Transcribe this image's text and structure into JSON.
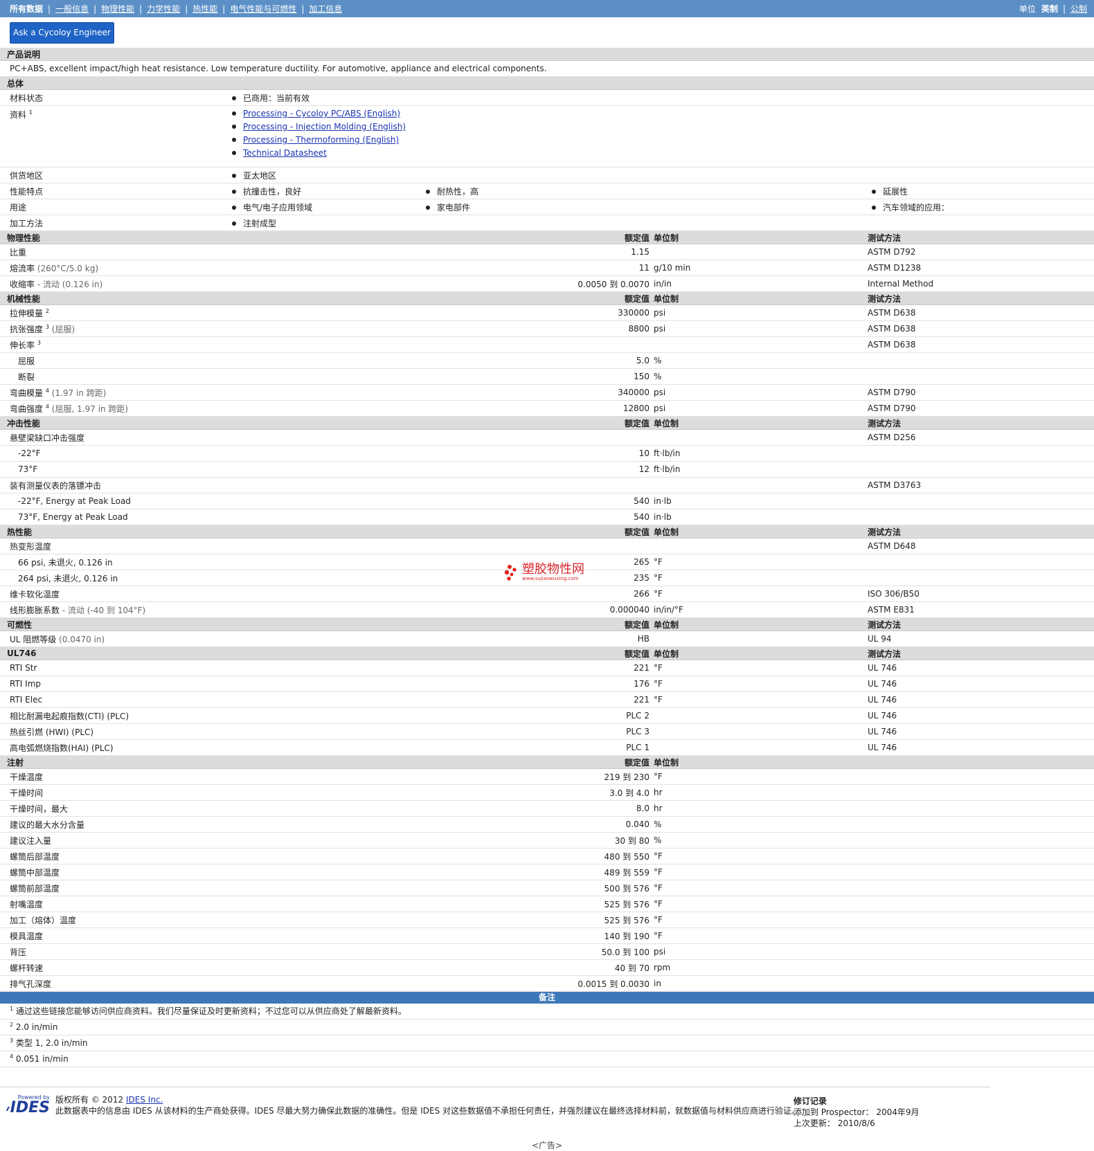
{
  "nav": {
    "items": [
      "所有数据",
      "一般信息",
      "物理性能",
      "力学性能",
      "热性能",
      "电气性能与可燃性",
      "加工信息"
    ],
    "units_label": "单位",
    "unit_english": "英制",
    "unit_metric": "公制"
  },
  "ask_button": "Ask a Cycoloy Engineer",
  "product": {
    "header": "产品说明",
    "desc": "PC+ABS, excellent impact/high heat resistance. Low temperature ductility. For automotive, appliance and electrical components."
  },
  "general": {
    "header": "总体",
    "status_label": "材料状态",
    "status_value": "已商用：当前有效",
    "docs_label": "资料",
    "docs_sup": "1",
    "docs": [
      "Processing - Cycoloy PC/ABS (English)",
      "Processing - Injection Molding (English)",
      "Processing - Thermoforming (English)",
      "Technical Datasheet"
    ],
    "region_label": "供货地区",
    "region_value": "亚太地区",
    "features_label": "性能特点",
    "features": [
      "抗撞击性，良好",
      "耐热性，高",
      "延展性"
    ],
    "uses_label": "用途",
    "uses": [
      "电气/电子应用领域",
      "家电部件",
      "汽车领域的应用："
    ],
    "process_label": "加工方法",
    "process_value": "注射成型"
  },
  "col": {
    "nominal": "额定值",
    "unit": "单位制",
    "method": "测试方法"
  },
  "physical": {
    "header": "物理性能",
    "rows": [
      {
        "label": "比重",
        "cond": "",
        "val": "1.15",
        "unit": "",
        "method": "ASTM D792"
      },
      {
        "label": "熔流率",
        "cond": "(260°C/5.0 kg)",
        "val": "11",
        "unit": "g/10 min",
        "method": "ASTM D1238"
      },
      {
        "label": "收缩率",
        "cond": "- 流动 (0.126 in)",
        "val": "0.0050 到 0.0070",
        "unit": "in/in",
        "method": "Internal Method"
      }
    ]
  },
  "mechanical": {
    "header": "机械性能",
    "rows": [
      {
        "label": "拉伸模量",
        "sup": "2",
        "cond": "",
        "val": "330000",
        "unit": "psi",
        "method": "ASTM D638"
      },
      {
        "label": "抗张强度",
        "sup": "3",
        "cond": "(屈服)",
        "val": "8800",
        "unit": "psi",
        "method": "ASTM D638"
      },
      {
        "label": "伸长率",
        "sup": "3",
        "cond": "",
        "val": "",
        "unit": "",
        "method": "ASTM D638"
      },
      {
        "label": "屈服",
        "sub": true,
        "val": "5.0",
        "unit": "%",
        "method": ""
      },
      {
        "label": "断裂",
        "sub": true,
        "val": "150",
        "unit": "%",
        "method": ""
      },
      {
        "label": "弯曲模量",
        "sup": "4",
        "cond": "(1.97 in 跨距)",
        "val": "340000",
        "unit": "psi",
        "method": "ASTM D790"
      },
      {
        "label": "弯曲强度",
        "sup": "4",
        "cond": "(屈服, 1.97 in 跨距)",
        "val": "12800",
        "unit": "psi",
        "method": "ASTM D790"
      }
    ]
  },
  "impact": {
    "header": "冲击性能",
    "rows": [
      {
        "label": "悬壁梁缺口冲击强度",
        "val": "",
        "unit": "",
        "method": "ASTM D256"
      },
      {
        "label": "-22°F",
        "sub": true,
        "val": "10",
        "unit": "ft·lb/in",
        "method": ""
      },
      {
        "label": "73°F",
        "sub": true,
        "val": "12",
        "unit": "ft·lb/in",
        "method": ""
      },
      {
        "label": "装有测量仪表的落镖冲击",
        "val": "",
        "unit": "",
        "method": "ASTM D3763"
      },
      {
        "label": "-22°F, Energy at Peak Load",
        "sub": true,
        "val": "540",
        "unit": "in·lb",
        "method": ""
      },
      {
        "label": "73°F, Energy at Peak Load",
        "sub": true,
        "val": "540",
        "unit": "in·lb",
        "method": ""
      }
    ]
  },
  "thermal": {
    "header": "热性能",
    "rows": [
      {
        "label": "热变形温度",
        "val": "",
        "unit": "",
        "method": "ASTM D648"
      },
      {
        "label": "66 psi, 未退火, 0.126 in",
        "sub": true,
        "val": "265",
        "unit": "°F",
        "method": ""
      },
      {
        "label": "264 psi, 未退火, 0.126 in",
        "sub": true,
        "val": "235",
        "unit": "°F",
        "method": ""
      },
      {
        "label": "维卡软化温度",
        "val": "266",
        "unit": "°F",
        "method": "ISO 306/B50"
      },
      {
        "label": "线形膨胀系数",
        "cond": "- 流动 (-40 到 104°F)",
        "val": "0.000040",
        "unit": "in/in/°F",
        "method": "ASTM E831"
      }
    ]
  },
  "flammability": {
    "header": "可燃性",
    "rows": [
      {
        "label": "UL 阻燃等级",
        "cond": "(0.0470 in)",
        "val": "HB",
        "unit": "",
        "method": "UL 94"
      }
    ]
  },
  "ul746": {
    "header": "UL746",
    "rows": [
      {
        "label": "RTI Str",
        "val": "221",
        "unit": "°F",
        "method": "UL 746"
      },
      {
        "label": "RTI Imp",
        "val": "176",
        "unit": "°F",
        "method": "UL 746"
      },
      {
        "label": "RTI Elec",
        "val": "221",
        "unit": "°F",
        "method": "UL 746"
      },
      {
        "label": "相比耐漏电起痕指数(CTI) (PLC)",
        "val": "PLC 2",
        "unit": "",
        "method": "UL 746"
      },
      {
        "label": "热丝引燃 (HWI) (PLC)",
        "val": "PLC 3",
        "unit": "",
        "method": "UL 746"
      },
      {
        "label": "高电弧燃烧指数(HAI) (PLC)",
        "val": "PLC 1",
        "unit": "",
        "method": "UL 746"
      }
    ]
  },
  "injection": {
    "header": "注射",
    "rows": [
      {
        "label": "干燥温度",
        "val": "219 到 230",
        "unit": "°F"
      },
      {
        "label": "干燥时间",
        "val": "3.0 到 4.0",
        "unit": "hr"
      },
      {
        "label": "干燥时间，最大",
        "val": "8.0",
        "unit": "hr"
      },
      {
        "label": "建议的最大水分含量",
        "val": "0.040",
        "unit": "%"
      },
      {
        "label": "建议注入量",
        "val": "30 到 80",
        "unit": "%"
      },
      {
        "label": "螺筒后部温度",
        "val": "480 到 550",
        "unit": "°F"
      },
      {
        "label": "螺筒中部温度",
        "val": "489 到 559",
        "unit": "°F"
      },
      {
        "label": "螺筒前部温度",
        "val": "500 到 576",
        "unit": "°F"
      },
      {
        "label": "射嘴温度",
        "val": "525 到 576",
        "unit": "°F"
      },
      {
        "label": "加工（熔体）温度",
        "val": "525 到 576",
        "unit": "°F"
      },
      {
        "label": "模具温度",
        "val": "140 到 190",
        "unit": "°F"
      },
      {
        "label": "背压",
        "val": "50.0 到 100",
        "unit": "psi"
      },
      {
        "label": "螺杆转速",
        "val": "40 到 70",
        "unit": "rpm"
      },
      {
        "label": "排气孔深度",
        "val": "0.0015 到 0.0030",
        "unit": "in"
      }
    ]
  },
  "notes": {
    "header": "备注",
    "items": [
      {
        "n": "1",
        "text": "通过这些链接您能够访问供应商资料。我们尽量保证及时更新资料；不过您可以从供应商处了解最新资料。"
      },
      {
        "n": "2",
        "text": "2.0 in/min"
      },
      {
        "n": "3",
        "text": "类型 1, 2.0 in/min"
      },
      {
        "n": "4",
        "text": "0.051 in/min"
      }
    ]
  },
  "footer": {
    "powered_by": "Powered by",
    "logo_text": "IDES",
    "copyright_prefix": "版权所有 © 2012",
    "copyright_link": "IDES Inc.",
    "disclaimer": "此数据表中的信息由 IDES 从该材料的生产商处获得。IDES 尽最大努力确保此数据的准确性。但是 IDES 对这些数据值不承担任何责任，并强烈建议在最终选择材料前，就数据值与材料供应商进行验证。",
    "rev_title": "修订记录",
    "added": "添加到 Prospector：  2004年9月",
    "updated": "上次更新：  2010/8/6"
  },
  "ad": "<广告>",
  "watermark": {
    "text": "塑胶物性网",
    "sub": "www.sujiaowuxing.com"
  }
}
